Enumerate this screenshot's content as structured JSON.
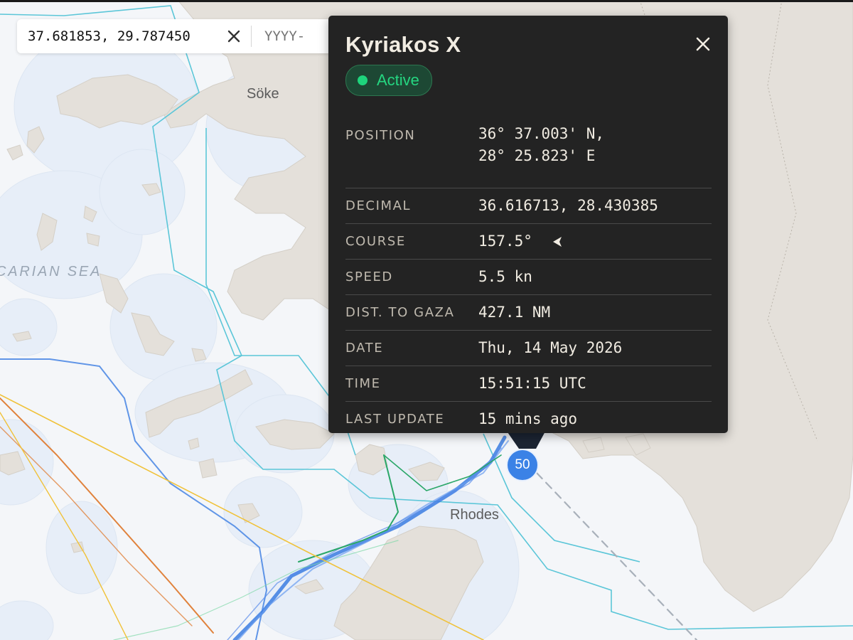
{
  "map": {
    "labels": {
      "soke": "Söke",
      "rhodes": "Rhodes",
      "sea": "CARIAN SEA"
    },
    "colors": {
      "water": "#f4f6f9",
      "land": "#e3dfd9",
      "boundary": "#5bc6d8",
      "route_blue": "#3b7de2",
      "route_green": "#2aa768",
      "route_orange": "#e0823c",
      "route_yellow": "#f0c23a"
    }
  },
  "search": {
    "coordinates_value": "37.681853, 29.787450",
    "date_placeholder": "YYYY-",
    "clear_icon": "close-icon"
  },
  "cluster": {
    "count": "50"
  },
  "popup": {
    "title": "Kyriakos X",
    "close_icon": "close-icon",
    "status": {
      "label": "Active",
      "color": "#1ed47c"
    },
    "rows": {
      "position": {
        "label": "POSITION",
        "value_lat": "36° 37.003' N,",
        "value_lon": "28° 25.823' E"
      },
      "decimal": {
        "label": "DECIMAL",
        "value": "36.616713, 28.430385"
      },
      "course": {
        "label": "COURSE",
        "value": "157.5°",
        "icon": "course-arrow-icon"
      },
      "speed": {
        "label": "SPEED",
        "value": "5.5 kn"
      },
      "dist": {
        "label": "DIST. TO GAZA",
        "value": "427.1 NM"
      },
      "date": {
        "label": "DATE",
        "value": "Thu, 14 May 2026"
      },
      "time": {
        "label": "TIME",
        "value": "15:51:15 UTC"
      },
      "last_update": {
        "label": "LAST UPDATE",
        "value": "15 mins ago"
      }
    }
  }
}
